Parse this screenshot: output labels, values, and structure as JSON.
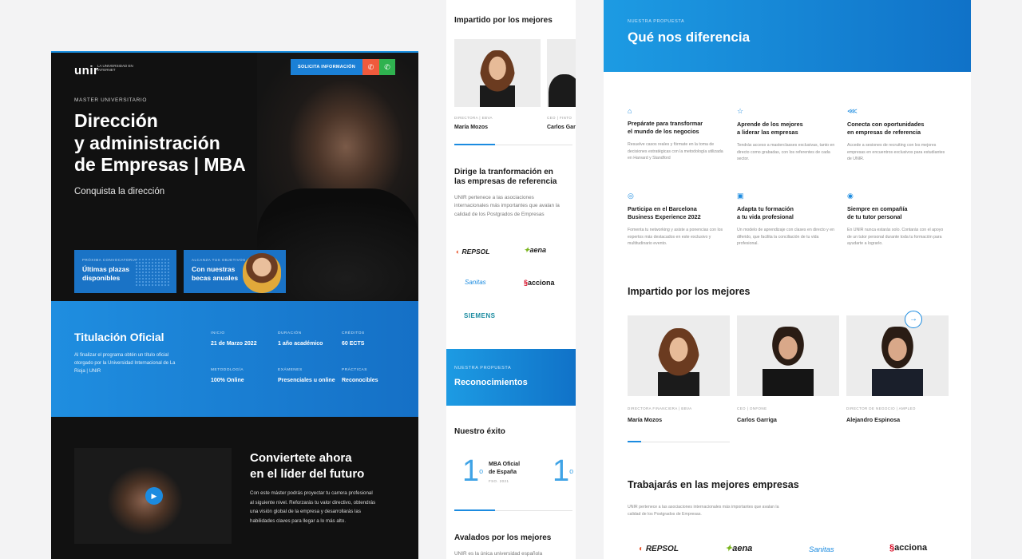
{
  "desktop": {
    "logo": "unir",
    "logo_tagline": "LA UNIVERSIDAD EN INTERNET",
    "cta_label": "SOLICITA INFORMACIÓN",
    "phone_icon": "✆",
    "whatsapp_icon": "✆",
    "eyebrow": "MASTER UNIVERSITARIO",
    "title_line1": "Dirección",
    "title_line2": "y administración",
    "title_line3": "de Empresas | MBA",
    "tagline": "Conquista la dirección",
    "card1": {
      "kicker": "PRÓXIMA CONVOCATORIA",
      "value": "Últimas plazas disponibles"
    },
    "card2": {
      "kicker": "ALCANZA TUS OBJETIVOS",
      "value": "Con nuestras becas anuales"
    },
    "titulacion": {
      "heading": "Titulación Oficial",
      "text": "Al finalizar el programa obtén un título oficial otorgado por la Universidad Internacional de La Rioja | UNIR",
      "stats": [
        {
          "k": "INICIO",
          "v": "21 de Marzo 2022"
        },
        {
          "k": "DURACIÓN",
          "v": "1 año académico"
        },
        {
          "k": "CRÉDITOS",
          "v": "60 ECTS"
        },
        {
          "k": "METODOLOGÍA",
          "v": "100% Online"
        },
        {
          "k": "EXÁMENES",
          "v": "Presenciales u online"
        },
        {
          "k": "PRÁCTICAS",
          "v": "Reconocibles"
        }
      ]
    },
    "play_icon": "▶",
    "conv_heading_1": "Conviertete ahora",
    "conv_heading_2": "en el líder del futuro",
    "conv_text": "Con este máster podrás proyectar tu carrera profesional al siguiente nivel. Reforzarás tu valor directivo, obtendrás una visión global de la empresa y desarrollarás las habilidades claves para llegar a lo más alto."
  },
  "mobile": {
    "impartido": "Impartido por los mejores",
    "people": [
      {
        "role": "DIRECTORA | EBVA",
        "name": "María Mozos"
      },
      {
        "role": "CEO | FINTO",
        "name": "Carlos Gar"
      }
    ],
    "dirige_1": "Dirige la tranformación en",
    "dirige_2": "las empresas de referencia",
    "dirige_text": "UNIR pertenece a las asociaciones internacionales más importantes que avalan la calidad de los Postgrados de Empresas",
    "logos": [
      "REPSOL",
      "aena",
      "Sanitas",
      "acciona",
      "SIEMENS"
    ],
    "prop_eyebrow": "NUESTRA PROPUESTA",
    "prop_title": "Reconocimientos",
    "exito": "Nuestro éxito",
    "rank": "1",
    "rank_sup": "o",
    "rank_label_1": "MBA Oficial",
    "rank_label_2": "de España",
    "rank_source": "FSO. 2021",
    "avalados": "Avalados por los mejores",
    "avalados_text": "UNIR es la única universidad española"
  },
  "right": {
    "eyebrow": "NUESTRA PROPUESTA",
    "title": "Qué nos diferencia",
    "features": [
      {
        "icon": "⌂",
        "h1": "Prepárate para transformar",
        "h2": "el mundo de los negocios",
        "p": "Resuelve casos reales y fórmate en la toma de decisiones estratégicas con la metodología utilizada en Harvard y Standford"
      },
      {
        "icon": "☆",
        "h1": "Aprende de los mejores",
        "h2": "a liderar las empresas",
        "p": "Tendrás acceso a masterclasses exclusivas, tanto en directo como grabadas, con los referentes de cada sector."
      },
      {
        "icon": "⋘",
        "h1": "Conecta con oportunidades",
        "h2": "en empresas de referencia",
        "p": "Accede a sesiones de recruiting con los mejores empresas en encuentros exclusivos para estudiantes de UNIR."
      },
      {
        "icon": "◎",
        "h1": "Participa en el Barcelona",
        "h2": "Business Experience 2022",
        "p": "Fomenta tu networking y asiste a ponencias con los expertos más destacados en este exclusivo y multitudinario evento."
      },
      {
        "icon": "▣",
        "h1": "Adapta tu formación",
        "h2": "a tu vida profesional",
        "p": "Un modelo de aprendizaje con clases en directo y en diferido, que facilita la conciliación de tu vida profesional."
      },
      {
        "icon": "◉",
        "h1": "Siempre en compañía",
        "h2": "de tu tutor personal",
        "p": "En UNIR nunca estarás solo. Contarás con el apoyo de un tutor personal durante toda tu formación para ayudarte a lograrlo."
      }
    ],
    "impartido": "Impartido por los mejores",
    "arrow_icon": "→",
    "people": [
      {
        "role": "DIRECTORA FINANCIERA | BBVA",
        "name": "María Mozos"
      },
      {
        "role": "CEO | ONFONE",
        "name": "Carlos Garriga"
      },
      {
        "role": "DIRECTOR DE NEGOCIO | AMPLEO",
        "name": "Alejandro Espinosa"
      }
    ],
    "trabajaras": "Trabajarás en las mejores empresas",
    "trabajaras_text": "UNIR pertenece a las asociaciones internacionales más importantes que avalan la calidad de los Postgrados de Empresas.",
    "logos": [
      "REPSOL",
      "aena",
      "Sanitas",
      "acciona"
    ]
  },
  "colors": {
    "accent": "#1b8be0",
    "dark": "#111111",
    "repsol": "#e8552b",
    "aena": "#7ab51d",
    "acciona": "#d6001c"
  }
}
